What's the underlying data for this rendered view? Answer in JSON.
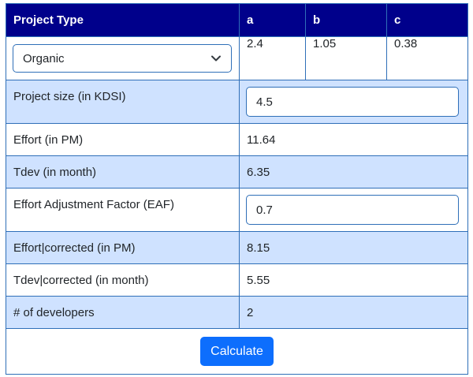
{
  "header": {
    "project_type": "Project Type",
    "a": "a",
    "b": "b",
    "c": "c"
  },
  "project_type": {
    "selected": "Organic",
    "a_value": "2.4",
    "b_value": "1.05",
    "c_value": "0.38"
  },
  "rows": {
    "project_size": {
      "label": "Project size (in KDSI)",
      "value": "4.5"
    },
    "effort": {
      "label": "Effort (in PM)",
      "value": "11.64"
    },
    "tdev": {
      "label": "Tdev (in month)",
      "value": "6.35"
    },
    "eaf": {
      "label": "Effort Adjustment Factor (EAF)",
      "value": "0.7"
    },
    "effort_corrected": {
      "label": "Effort|corrected (in PM)",
      "value": "8.15"
    },
    "tdev_corrected": {
      "label": "Tdev|corrected (in month)",
      "value": "5.55"
    },
    "developers": {
      "label": "# of developers",
      "value": "2"
    }
  },
  "actions": {
    "calculate_label": "Calculate"
  },
  "colors": {
    "header_bg": "#00008b",
    "tinted_row": "#cfe2ff",
    "border": "#2f6fb8",
    "button": "#0d6efd"
  },
  "icons": {
    "select_chevron": "chevron-down-icon"
  }
}
